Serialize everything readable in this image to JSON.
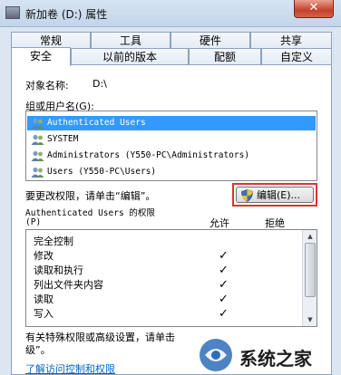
{
  "window": {
    "title": "新加卷 (D:) 属性",
    "close_glyph": "✕"
  },
  "tabs_back": [
    "常规",
    "工具",
    "硬件",
    "共享"
  ],
  "tabs_front": [
    "安全",
    "以前的版本",
    "配额",
    "自定义"
  ],
  "object": {
    "label": "对象名称:",
    "value": "D:\\"
  },
  "groups_label": "组或用户名(G):",
  "users": [
    "Authenticated Users",
    "SYSTEM",
    "Administrators (Y550-PC\\Administrators)",
    "Users (Y550-PC\\Users)"
  ],
  "change_hint": "要更改权限，请单击“编辑”。",
  "edit_button_label": "编辑(E)...",
  "permissions": {
    "header_line1": "Authenticated Users 的权限",
    "header_line2": "(P)",
    "allow_label": "允许",
    "deny_label": "拒绝",
    "rows": [
      {
        "name": "完全控制",
        "allow": false
      },
      {
        "name": "修改",
        "allow": true
      },
      {
        "name": "读取和执行",
        "allow": true
      },
      {
        "name": "列出文件夹内容",
        "allow": true
      },
      {
        "name": "读取",
        "allow": true
      },
      {
        "name": "写入",
        "allow": true
      }
    ],
    "check_glyph": "✓"
  },
  "special_hint_line1": "有关特殊权限或高级设置，请单击",
  "special_hint_line2": "级”。",
  "learn_link": "了解访问控制和权限",
  "watermark_text": "系统之家"
}
